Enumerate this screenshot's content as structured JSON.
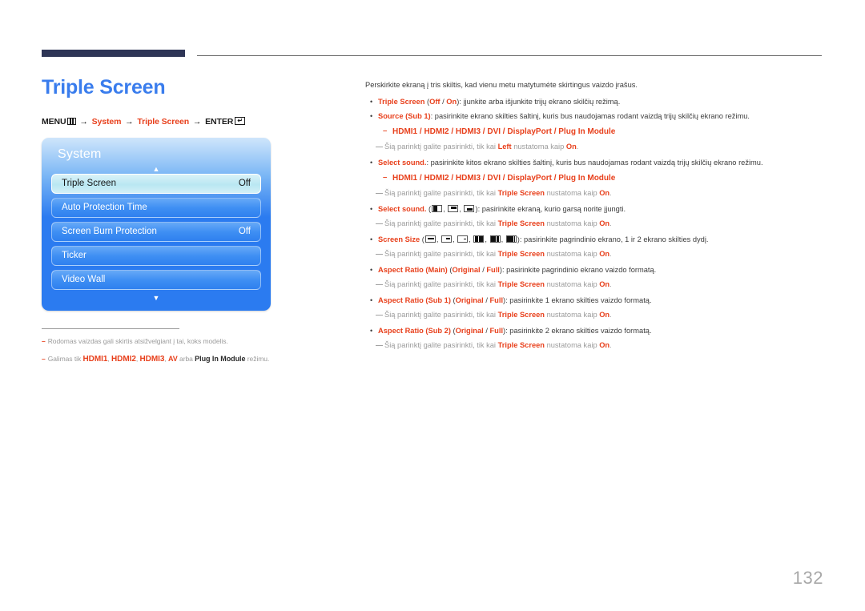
{
  "page": {
    "title": "Triple Screen",
    "number": "132",
    "title_color": "#3a7ded",
    "accent_color": "#e8401c"
  },
  "menu_path": {
    "menu_label": "MENU",
    "menu_icon": "menu-bars-icon",
    "arrow": "→",
    "step1": "System",
    "step2": "Triple Screen",
    "enter_label": "ENTER",
    "enter_icon": "enter-key-icon",
    "enter_glyph": "↵"
  },
  "osd": {
    "panel_title": "System",
    "scroll_up_icon": "▲",
    "scroll_down_icon": "▼",
    "items": [
      {
        "label": "Triple Screen",
        "value": "Off",
        "selected": true
      },
      {
        "label": "Auto Protection Time",
        "value": "",
        "selected": false
      },
      {
        "label": "Screen Burn Protection",
        "value": "Off",
        "selected": false
      },
      {
        "label": "Ticker",
        "value": "",
        "selected": false
      },
      {
        "label": "Video Wall",
        "value": "",
        "selected": false
      }
    ]
  },
  "left_footnotes": [
    {
      "dash": "–",
      "parts": [
        {
          "text": "Rodomas vaizdas gali skirtis atsižvelgiant į tai, koks modelis.",
          "style": "plain"
        }
      ]
    },
    {
      "dash": "–",
      "parts": [
        {
          "text": "Galimas tik ",
          "style": "plain"
        },
        {
          "text": "HDMI1",
          "style": "red-big"
        },
        {
          "text": ", ",
          "style": "plain"
        },
        {
          "text": "HDMI2",
          "style": "red-big"
        },
        {
          "text": ", ",
          "style": "plain"
        },
        {
          "text": "HDMI3",
          "style": "red-big"
        },
        {
          "text": ", ",
          "style": "plain"
        },
        {
          "text": "AV",
          "style": "red-small"
        },
        {
          "text": " arba ",
          "style": "plain"
        },
        {
          "text": "Plug In Module",
          "style": "dark"
        },
        {
          "text": " režimu.",
          "style": "plain"
        }
      ]
    }
  ],
  "right": {
    "intro": "Perskirkite ekraną į tris skiltis, kad vienu metu matytumėte skirtingus vaizdo įrašus.",
    "note_dash": "—",
    "bullet_dot": "•",
    "sub_dash": "–",
    "blocks": [
      {
        "type": "bullet",
        "parts": [
          {
            "text": "Triple Screen",
            "style": "red"
          },
          {
            "text": " (",
            "style": "plain"
          },
          {
            "text": "Off",
            "style": "red"
          },
          {
            "text": " / ",
            "style": "plain"
          },
          {
            "text": "On",
            "style": "red"
          },
          {
            "text": "): įjunkite arba išjunkite trijų ekrano skilčių režimą.",
            "style": "plain"
          }
        ]
      },
      {
        "type": "bullet",
        "parts": [
          {
            "text": "Source (Sub 1)",
            "style": "red"
          },
          {
            "text": ": pasirinkite ekrano skilties šaltinį, kuris bus naudojamas rodant vaizdą trijų skilčių ekrano režimu.",
            "style": "plain"
          }
        ]
      },
      {
        "type": "sub",
        "text": "HDMI1 / HDMI2 / HDMI3 / DVI / DisplayPort / Plug In Module"
      },
      {
        "type": "note",
        "parts": [
          {
            "text": "Šią parinktį galite pasirinkti, tik kai ",
            "style": "plain"
          },
          {
            "text": "Left",
            "style": "red"
          },
          {
            "text": " nustatoma kaip ",
            "style": "plain"
          },
          {
            "text": "On",
            "style": "red"
          },
          {
            "text": ".",
            "style": "plain"
          }
        ]
      },
      {
        "type": "bullet",
        "parts": [
          {
            "text": "Select sound.",
            "style": "red"
          },
          {
            "text": ": pasirinkite kitos ekrano skilties šaltinį, kuris bus naudojamas rodant vaizdą trijų skilčių ekrano režimu.",
            "style": "plain"
          }
        ]
      },
      {
        "type": "sub",
        "text": "HDMI1 / HDMI2 / HDMI3 / DVI / DisplayPort / Plug In Module"
      },
      {
        "type": "note",
        "parts": [
          {
            "text": "Šią parinktį galite pasirinkti, tik kai ",
            "style": "plain"
          },
          {
            "text": "Triple Screen",
            "style": "red"
          },
          {
            "text": " nustatoma kaip ",
            "style": "plain"
          },
          {
            "text": "On",
            "style": "red"
          },
          {
            "text": ".",
            "style": "plain"
          }
        ]
      },
      {
        "type": "bullet-icons-sound",
        "label": "Select sound.",
        "icons": [
          "screen-left-half-icon",
          "screen-top-bar-icon",
          "screen-bottom-bar-icon"
        ],
        "tail": "): pasirinkite ekraną, kurio garsą norite įjungti.",
        "open": " ("
      },
      {
        "type": "note",
        "parts": [
          {
            "text": "Šią parinktį galite pasirinkti, tik kai ",
            "style": "plain"
          },
          {
            "text": "Triple Screen",
            "style": "red"
          },
          {
            "text": " nustatoma kaip ",
            "style": "plain"
          },
          {
            "text": "On",
            "style": "red"
          },
          {
            "text": ".",
            "style": "plain"
          }
        ]
      },
      {
        "type": "bullet-icons-size",
        "label": "Screen Size",
        "icons": [
          "screen-size-1-icon",
          "screen-size-2-icon",
          "screen-size-3-icon",
          "screen-size-4-icon",
          "screen-size-5-icon",
          "screen-size-6-icon"
        ],
        "tail": "): pasirinkite pagrindinio ekrano, 1 ir 2 ekrano skilties dydį.",
        "open": " ("
      },
      {
        "type": "note",
        "parts": [
          {
            "text": "Šią parinktį galite pasirinkti, tik kai ",
            "style": "plain"
          },
          {
            "text": "Triple Screen",
            "style": "red"
          },
          {
            "text": " nustatoma kaip ",
            "style": "plain"
          },
          {
            "text": "On",
            "style": "red"
          },
          {
            "text": ".",
            "style": "plain"
          }
        ]
      },
      {
        "type": "bullet",
        "parts": [
          {
            "text": "Aspect Ratio (Main)",
            "style": "red"
          },
          {
            "text": " (",
            "style": "plain"
          },
          {
            "text": "Original",
            "style": "red"
          },
          {
            "text": " / ",
            "style": "plain"
          },
          {
            "text": "Full",
            "style": "red"
          },
          {
            "text": "): pasirinkite pagrindinio ekrano vaizdo formatą.",
            "style": "plain"
          }
        ]
      },
      {
        "type": "note",
        "parts": [
          {
            "text": "Šią parinktį galite pasirinkti, tik kai ",
            "style": "plain"
          },
          {
            "text": "Triple Screen",
            "style": "red"
          },
          {
            "text": " nustatoma kaip ",
            "style": "plain"
          },
          {
            "text": "On",
            "style": "red"
          },
          {
            "text": ".",
            "style": "plain"
          }
        ]
      },
      {
        "type": "bullet",
        "parts": [
          {
            "text": "Aspect Ratio (Sub 1)",
            "style": "red"
          },
          {
            "text": " (",
            "style": "plain"
          },
          {
            "text": "Original",
            "style": "red"
          },
          {
            "text": " / ",
            "style": "plain"
          },
          {
            "text": "Full",
            "style": "red"
          },
          {
            "text": "): pasirinkite 1 ekrano skilties vaizdo formatą.",
            "style": "plain"
          }
        ]
      },
      {
        "type": "note",
        "parts": [
          {
            "text": "Šią parinktį galite pasirinkti, tik kai ",
            "style": "plain"
          },
          {
            "text": "Triple Screen",
            "style": "red"
          },
          {
            "text": " nustatoma kaip ",
            "style": "plain"
          },
          {
            "text": "On",
            "style": "red"
          },
          {
            "text": ".",
            "style": "plain"
          }
        ]
      },
      {
        "type": "bullet",
        "parts": [
          {
            "text": "Aspect Ratio (Sub 2)",
            "style": "red"
          },
          {
            "text": " (",
            "style": "plain"
          },
          {
            "text": "Original",
            "style": "red"
          },
          {
            "text": " / ",
            "style": "plain"
          },
          {
            "text": "Full",
            "style": "red"
          },
          {
            "text": "): pasirinkite 2 ekrano skilties vaizdo formatą.",
            "style": "plain"
          }
        ]
      },
      {
        "type": "note",
        "parts": [
          {
            "text": "Šią parinktį galite pasirinkti, tik kai ",
            "style": "plain"
          },
          {
            "text": "Triple Screen",
            "style": "red"
          },
          {
            "text": " nustatoma kaip ",
            "style": "plain"
          },
          {
            "text": "On",
            "style": "red"
          },
          {
            "text": ".",
            "style": "plain"
          }
        ]
      }
    ]
  }
}
